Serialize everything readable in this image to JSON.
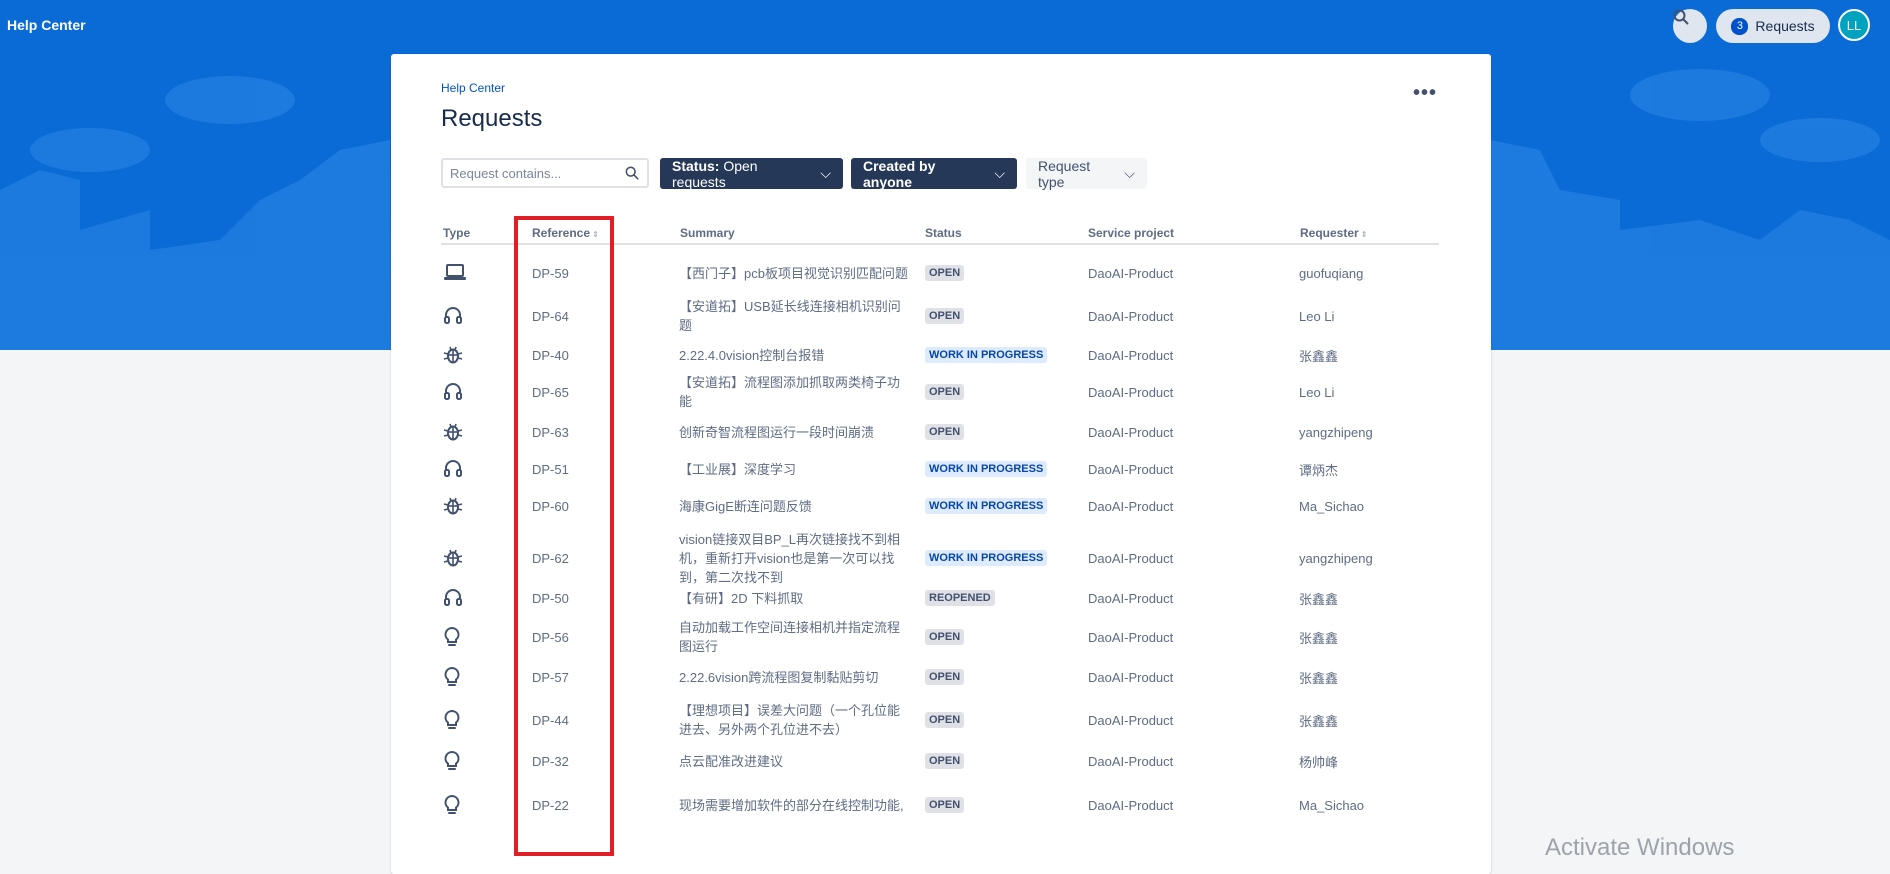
{
  "topbar": {
    "title": "Help Center",
    "requests_label": "Requests",
    "requests_count": "3",
    "avatar_initials": "LL"
  },
  "page": {
    "breadcrumb": "Help Center",
    "title": "Requests",
    "more_label": "•••"
  },
  "filters": {
    "search_placeholder": "Request contains...",
    "status_label": "Status:",
    "status_value": "Open requests",
    "created_by": "Created by anyone",
    "request_type": "Request type"
  },
  "table": {
    "headers": {
      "type": "Type",
      "reference": "Reference",
      "summary": "Summary",
      "status": "Status",
      "service_project": "Service project",
      "requester": "Requester"
    },
    "rows": [
      {
        "type": "laptop-icon",
        "reference": "DP-59",
        "summary": "【西门子】pcb板项目视觉识别匹配问题",
        "status": "OPEN",
        "project": "DaoAI-Product",
        "requester": "guofuqiang"
      },
      {
        "type": "headset-icon",
        "reference": "DP-64",
        "summary": "【安道拓】USB延长线连接相机识别问题",
        "status": "OPEN",
        "project": "DaoAI-Product",
        "requester": "Leo Li"
      },
      {
        "type": "bug-icon",
        "reference": "DP-40",
        "summary": "2.22.4.0vision控制台报错",
        "status": "WORK IN PROGRESS",
        "project": "DaoAI-Product",
        "requester": "张鑫鑫"
      },
      {
        "type": "headset-icon",
        "reference": "DP-65",
        "summary": "【安道拓】流程图添加抓取两类椅子功能",
        "status": "OPEN",
        "project": "DaoAI-Product",
        "requester": "Leo Li"
      },
      {
        "type": "bug-icon",
        "reference": "DP-63",
        "summary": "创新奇智流程图运行一段时间崩溃",
        "status": "OPEN",
        "project": "DaoAI-Product",
        "requester": "yangzhipeng"
      },
      {
        "type": "headset-icon",
        "reference": "DP-51",
        "summary": "【工业展】深度学习",
        "status": "WORK IN PROGRESS",
        "project": "DaoAI-Product",
        "requester": "谭炳杰"
      },
      {
        "type": "bug-icon",
        "reference": "DP-60",
        "summary": "海康GigE断连问题反馈",
        "status": "WORK IN PROGRESS",
        "project": "DaoAI-Product",
        "requester": "Ma_Sichao"
      },
      {
        "type": "bug-icon",
        "reference": "DP-62",
        "summary": "vision链接双目BP_L再次链接找不到相机，重新打开vision也是第一次可以找到，第二次找不到",
        "status": "WORK IN PROGRESS",
        "project": "DaoAI-Product",
        "requester": "yangzhipeng"
      },
      {
        "type": "headset-icon",
        "reference": "DP-50",
        "summary": "【有研】2D 下料抓取",
        "status": "REOPENED",
        "project": "DaoAI-Product",
        "requester": "张鑫鑫"
      },
      {
        "type": "lightbulb-icon",
        "reference": "DP-56",
        "summary": "自动加载工作空间连接相机并指定流程图运行",
        "status": "OPEN",
        "project": "DaoAI-Product",
        "requester": "张鑫鑫"
      },
      {
        "type": "lightbulb-icon",
        "reference": "DP-57",
        "summary": "2.22.6vision跨流程图复制黏贴剪切",
        "status": "OPEN",
        "project": "DaoAI-Product",
        "requester": "张鑫鑫"
      },
      {
        "type": "lightbulb-icon",
        "reference": "DP-44",
        "summary": "【理想项目】误差大问题（一个孔位能进去、另外两个孔位进不去）",
        "status": "OPEN",
        "project": "DaoAI-Product",
        "requester": "张鑫鑫"
      },
      {
        "type": "lightbulb-icon",
        "reference": "DP-32",
        "summary": "点云配准改进建议",
        "status": "OPEN",
        "project": "DaoAI-Product",
        "requester": "杨帅峰"
      },
      {
        "type": "lightbulb-icon",
        "reference": "DP-22",
        "summary": "现场需要增加软件的部分在线控制功能,",
        "status": "OPEN",
        "project": "DaoAI-Product",
        "requester": "Ma_Sichao"
      }
    ]
  },
  "watermark": "Activate Windows",
  "colors": {
    "banner": "#0a6bd6",
    "highlight": "#e01e26",
    "dark_filter": "#253858"
  }
}
